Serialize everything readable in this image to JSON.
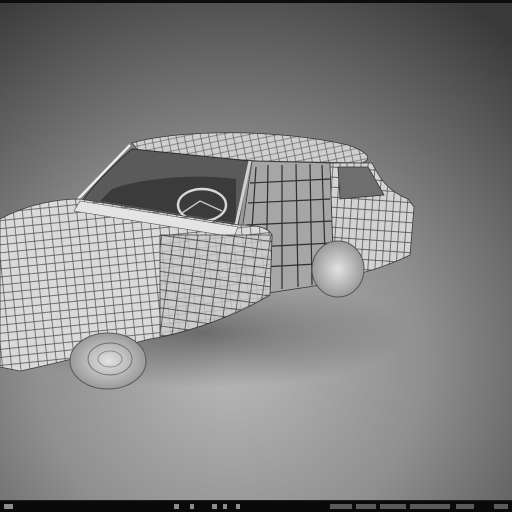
{
  "viewport": {
    "model": "car-wireframe-mesh",
    "background_colors": {
      "top": "#3a3a3a",
      "middle": "#8c8c8c",
      "floor": "#b4b4b4"
    },
    "mesh_color": "#d9d9d9",
    "wire_color": "#4a4a4a",
    "shadow_color": "#5a5a5a"
  },
  "status_bar": {
    "background": "#0a0a0a",
    "icons": [
      "left-tool-icon",
      "tool-icon-1",
      "tool-icon-2",
      "tool-icon-3",
      "tool-icon-4",
      "tool-icon-5"
    ],
    "info_text": ""
  }
}
